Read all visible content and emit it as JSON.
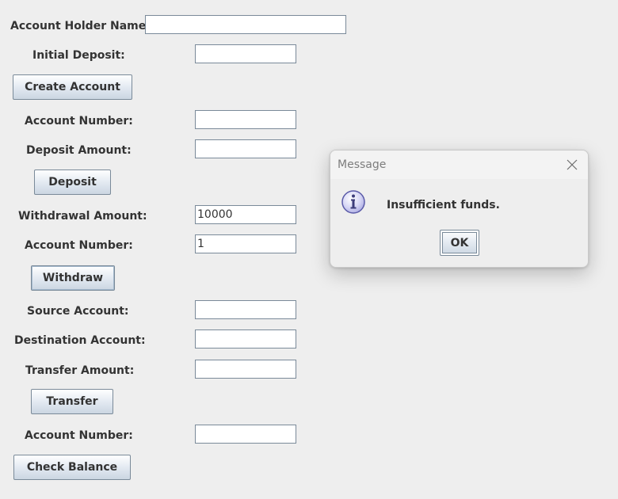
{
  "create_account": {
    "holder_name_label": "Account Holder Name:",
    "holder_name_value": "",
    "initial_deposit_label": "Initial Deposit:",
    "initial_deposit_value": "",
    "button_label": "Create Account"
  },
  "deposit": {
    "account_number_label": "Account Number:",
    "account_number_value": "",
    "amount_label": "Deposit Amount:",
    "amount_value": "",
    "button_label": "Deposit"
  },
  "withdraw": {
    "amount_label": "Withdrawal Amount:",
    "amount_value": "10000",
    "account_number_label": "Account Number:",
    "account_number_value": "1",
    "button_label": "Withdraw"
  },
  "transfer": {
    "source_label": "Source Account:",
    "source_value": "",
    "destination_label": "Destination Account:",
    "destination_value": "",
    "amount_label": "Transfer Amount:",
    "amount_value": "",
    "button_label": "Transfer"
  },
  "balance": {
    "account_number_label": "Account Number:",
    "account_number_value": "",
    "button_label": "Check Balance"
  },
  "dialog": {
    "title": "Message",
    "message": "Insufficient funds.",
    "ok_label": "OK",
    "icon": "info-icon",
    "close_icon": "close-icon"
  },
  "colors": {
    "background": "#eeeeee",
    "text": "#333333",
    "field_border": "#7a8a99",
    "button_gradient_top": "#ffffff",
    "button_gradient_bottom": "#cbd6e2",
    "info_icon_fill": "#c9c9f2",
    "info_icon_stroke": "#5a5aa8"
  }
}
